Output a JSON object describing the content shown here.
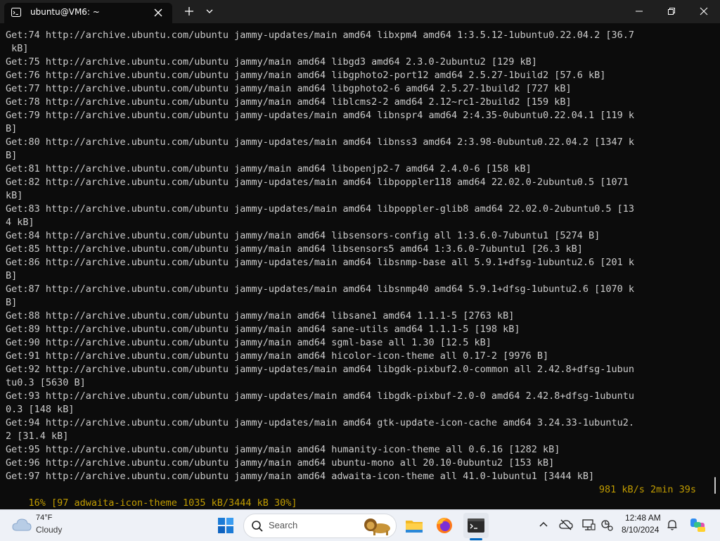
{
  "window": {
    "tab_title": "ubuntu@VM6: ~",
    "icons": {
      "tab": "terminal-icon",
      "tab_close": "close-icon",
      "new_tab": "plus-icon",
      "dropdown": "chevron-down-icon",
      "minimize": "minimize-icon",
      "maximize": "maximize-icon",
      "close": "close-icon"
    }
  },
  "terminal": {
    "background": "#0c0c0c",
    "text_color": "#cccccc",
    "status_color": "#c19c00",
    "lines": [
      "Get:74 http://archive.ubuntu.com/ubuntu jammy-updates/main amd64 libxpm4 amd64 1:3.5.12-1ubuntu0.22.04.2 [36.7",
      " kB]",
      "Get:75 http://archive.ubuntu.com/ubuntu jammy/main amd64 libgd3 amd64 2.3.0-2ubuntu2 [129 kB]",
      "Get:76 http://archive.ubuntu.com/ubuntu jammy/main amd64 libgphoto2-port12 amd64 2.5.27-1build2 [57.6 kB]",
      "Get:77 http://archive.ubuntu.com/ubuntu jammy/main amd64 libgphoto2-6 amd64 2.5.27-1build2 [727 kB]",
      "Get:78 http://archive.ubuntu.com/ubuntu jammy/main amd64 liblcms2-2 amd64 2.12~rc1-2build2 [159 kB]",
      "Get:79 http://archive.ubuntu.com/ubuntu jammy-updates/main amd64 libnspr4 amd64 2:4.35-0ubuntu0.22.04.1 [119 k",
      "B]",
      "Get:80 http://archive.ubuntu.com/ubuntu jammy-updates/main amd64 libnss3 amd64 2:3.98-0ubuntu0.22.04.2 [1347 k",
      "B]",
      "Get:81 http://archive.ubuntu.com/ubuntu jammy/main amd64 libopenjp2-7 amd64 2.4.0-6 [158 kB]",
      "Get:82 http://archive.ubuntu.com/ubuntu jammy-updates/main amd64 libpoppler118 amd64 22.02.0-2ubuntu0.5 [1071",
      "kB]",
      "Get:83 http://archive.ubuntu.com/ubuntu jammy-updates/main amd64 libpoppler-glib8 amd64 22.02.0-2ubuntu0.5 [13",
      "4 kB]",
      "Get:84 http://archive.ubuntu.com/ubuntu jammy/main amd64 libsensors-config all 1:3.6.0-7ubuntu1 [5274 B]",
      "Get:85 http://archive.ubuntu.com/ubuntu jammy/main amd64 libsensors5 amd64 1:3.6.0-7ubuntu1 [26.3 kB]",
      "Get:86 http://archive.ubuntu.com/ubuntu jammy-updates/main amd64 libsnmp-base all 5.9.1+dfsg-1ubuntu2.6 [201 k",
      "B]",
      "Get:87 http://archive.ubuntu.com/ubuntu jammy-updates/main amd64 libsnmp40 amd64 5.9.1+dfsg-1ubuntu2.6 [1070 k",
      "B]",
      "Get:88 http://archive.ubuntu.com/ubuntu jammy/main amd64 libsane1 amd64 1.1.1-5 [2763 kB]",
      "Get:89 http://archive.ubuntu.com/ubuntu jammy/main amd64 sane-utils amd64 1.1.1-5 [198 kB]",
      "Get:90 http://archive.ubuntu.com/ubuntu jammy/main amd64 sgml-base all 1.30 [12.5 kB]",
      "Get:91 http://archive.ubuntu.com/ubuntu jammy/main amd64 hicolor-icon-theme all 0.17-2 [9976 B]",
      "Get:92 http://archive.ubuntu.com/ubuntu jammy-updates/main amd64 libgdk-pixbuf2.0-common all 2.42.8+dfsg-1ubun",
      "tu0.3 [5630 B]",
      "Get:93 http://archive.ubuntu.com/ubuntu jammy-updates/main amd64 libgdk-pixbuf-2.0-0 amd64 2.42.8+dfsg-1ubuntu",
      "0.3 [148 kB]",
      "Get:94 http://archive.ubuntu.com/ubuntu jammy-updates/main amd64 gtk-update-icon-cache amd64 3.24.33-1ubuntu2.",
      "2 [31.4 kB]",
      "Get:95 http://archive.ubuntu.com/ubuntu jammy/main amd64 humanity-icon-theme all 0.6.16 [1282 kB]",
      "Get:96 http://archive.ubuntu.com/ubuntu jammy/main amd64 ubuntu-mono all 20.10-0ubuntu2 [153 kB]",
      "Get:97 http://archive.ubuntu.com/ubuntu jammy/main amd64 adwaita-icon-theme all 41.0-1ubuntu1 [3444 kB]"
    ],
    "status_left": "16% [97 adwaita-icon-theme 1035 kB/3444 kB 30%]",
    "status_right": "981 kB/s 2min 39s"
  },
  "taskbar": {
    "weather": {
      "temp": "74°F",
      "condition": "Cloudy",
      "icon": "cloud-icon"
    },
    "search_label": "Search",
    "apps": [
      "start-icon",
      "file-explorer-icon",
      "firefox-icon",
      "terminal-icon"
    ],
    "tray": [
      "chevron-up-icon",
      "cloud-offline-icon",
      "network-icon",
      "sync-icon",
      "bell-icon",
      "copilot-icon"
    ],
    "clock": {
      "time": "12:48 AM",
      "date": "8/10/2024"
    },
    "accent": "#0067c0"
  }
}
